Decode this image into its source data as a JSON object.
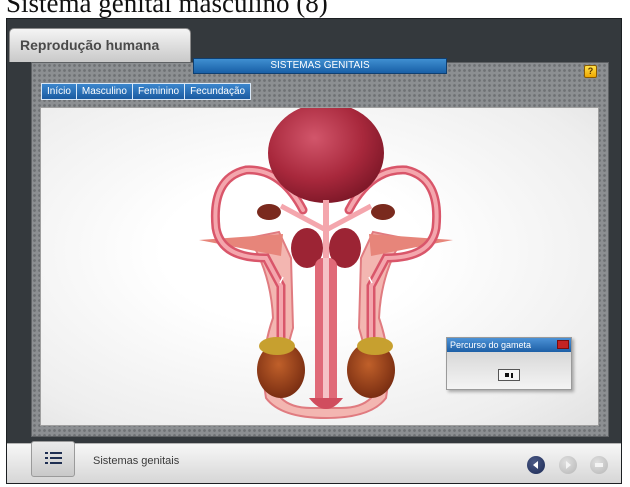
{
  "caption": "Sistema genital masculino (8)",
  "app": {
    "title": "Reprodução humana"
  },
  "section": {
    "title": "SISTEMAS GENITAIS"
  },
  "nav": {
    "tabs": [
      {
        "label": "Início"
      },
      {
        "label": "Masculino",
        "active": true
      },
      {
        "label": "Feminino"
      },
      {
        "label": "Fecundação"
      }
    ]
  },
  "popup": {
    "title": "Percurso do gameta",
    "control_icon": "stop-pause-icon"
  },
  "footer": {
    "label": "Sistemas genitais"
  },
  "icons": {
    "help": "help-book-icon",
    "menu": "list-menu-icon",
    "back": "arrow-left-circle-icon",
    "forward": "arrow-right-circle-icon",
    "end": "stop-circle-icon"
  },
  "colors": {
    "accent_blue": "#1d5fa6",
    "organ_dark": "#a0293a",
    "organ_light": "#e8808a",
    "close_red": "#c42323"
  }
}
